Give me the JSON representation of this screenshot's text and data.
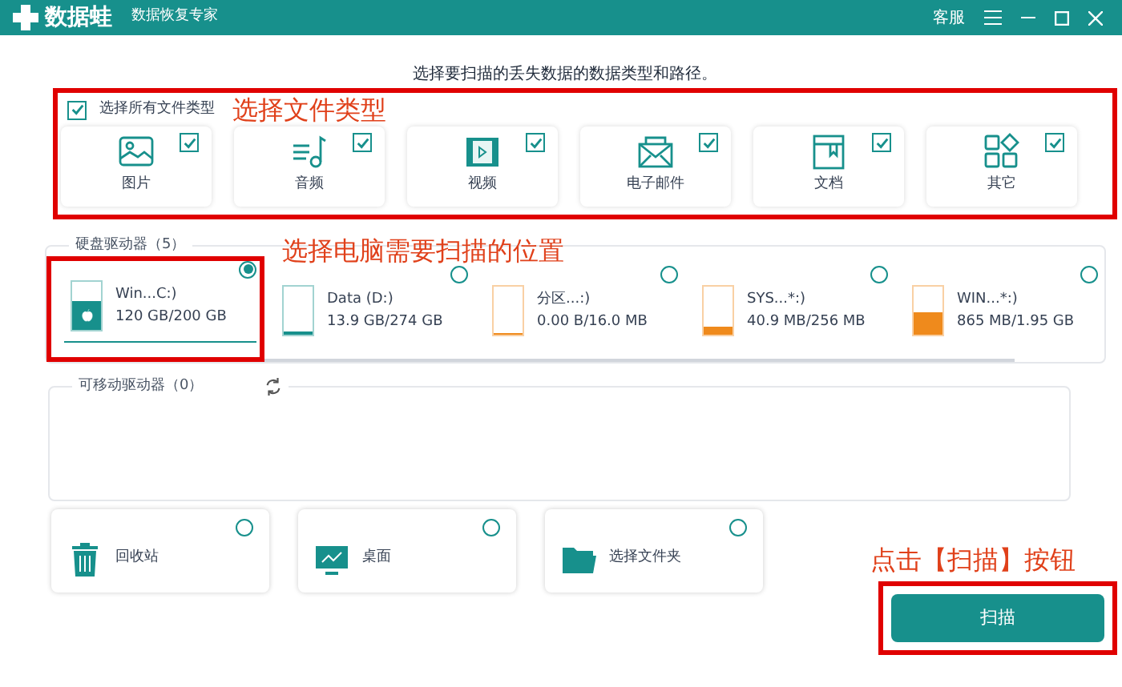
{
  "app": {
    "logo": "数据蛙",
    "tagline": "数据恢复专家",
    "support": "客服"
  },
  "instruction": "选择要扫描的丢失数据的数据类型和路径。",
  "file_types": {
    "select_all": {
      "label": "选择所有文件类型",
      "checked": true
    },
    "items": [
      {
        "label": "图片",
        "checked": true
      },
      {
        "label": "音频",
        "checked": true
      },
      {
        "label": "视频",
        "checked": true
      },
      {
        "label": "电子邮件",
        "checked": true
      },
      {
        "label": "文档",
        "checked": true
      },
      {
        "label": "其它",
        "checked": true
      }
    ]
  },
  "hard_drives": {
    "title": "硬盘驱动器（5）",
    "items": [
      {
        "name": "Win...C:)",
        "usage": "120 GB/200 GB",
        "level": 0.6,
        "color": "#17908c",
        "kind": "system",
        "selected": true
      },
      {
        "name": "Data (D:)",
        "usage": "13.9 GB/274 GB",
        "level": 0.05,
        "color": "#17908c",
        "kind": "data",
        "selected": false
      },
      {
        "name": "分区...:)",
        "usage": "0.00 B/16.0 MB",
        "level": 0,
        "color": "#ef8a1c",
        "kind": "data",
        "selected": false
      },
      {
        "name": "SYS...*:)",
        "usage": "40.9 MB/256 MB",
        "level": 0.16,
        "color": "#ef8a1c",
        "kind": "data",
        "selected": false
      },
      {
        "name": "WIN...*:)",
        "usage": "865 MB/1.95 GB",
        "level": 0.44,
        "color": "#ef8a1c",
        "kind": "data",
        "selected": false
      }
    ]
  },
  "removable_drives": {
    "title": "可移动驱动器（0）"
  },
  "locations": [
    {
      "label": "回收站",
      "selected": false
    },
    {
      "label": "桌面",
      "selected": false
    },
    {
      "label": "选择文件夹",
      "selected": false
    }
  ],
  "scan_button": "扫描",
  "annotations": [
    "选择文件类型",
    "选择电脑需要扫描的位置",
    "点击【扫描】按钮"
  ]
}
